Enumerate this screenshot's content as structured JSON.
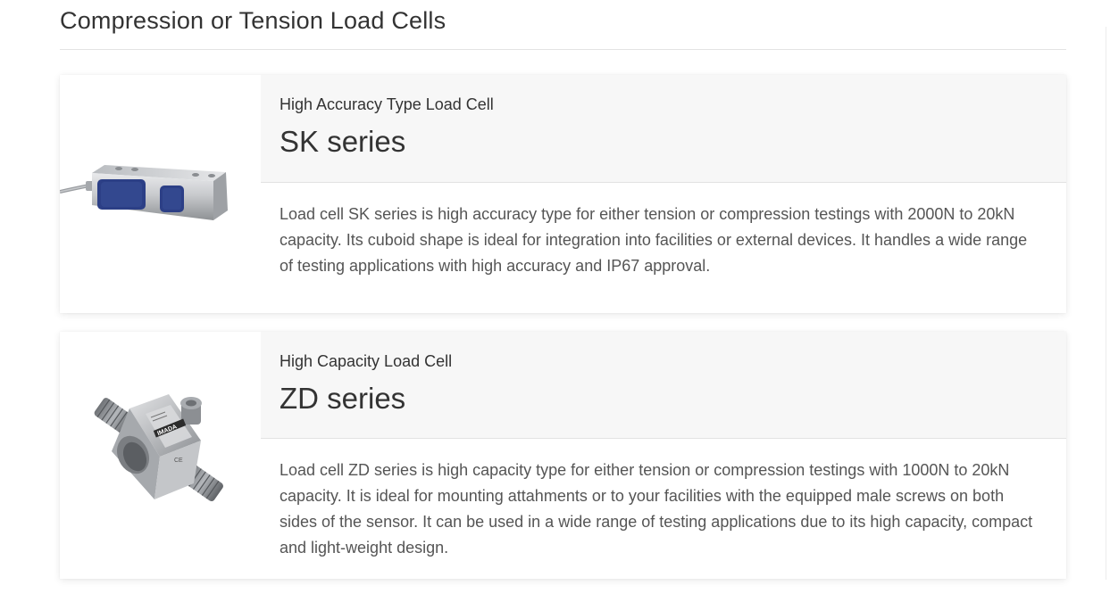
{
  "section": {
    "title": "Compression or Tension Load Cells"
  },
  "products": [
    {
      "subtitle": "High Accuracy Type Load Cell",
      "title": "SK series",
      "description": "Load cell SK series is high accuracy type for either tension or compression testings with 2000N to 20kN capacity. Its cuboid shape is ideal for integration into facilities or external devices. It handles a wide range of testing applications with high accuracy and IP67 approval.",
      "image": "sk-series-load-cell-photo"
    },
    {
      "subtitle": "High Capacity Load Cell",
      "title": "ZD series",
      "description": "Load cell ZD series is high capacity type for either tension or compression testings with 1000N to 20kN capacity. It is ideal for mounting attahments or to your facilities with the equipped male screws on both sides of the sensor. It can be used in a wide range of testing applications due to its high capacity, compact and light-weight design.",
      "image": "zd-series-load-cell-photo",
      "logo_text": "IMADA"
    }
  ]
}
